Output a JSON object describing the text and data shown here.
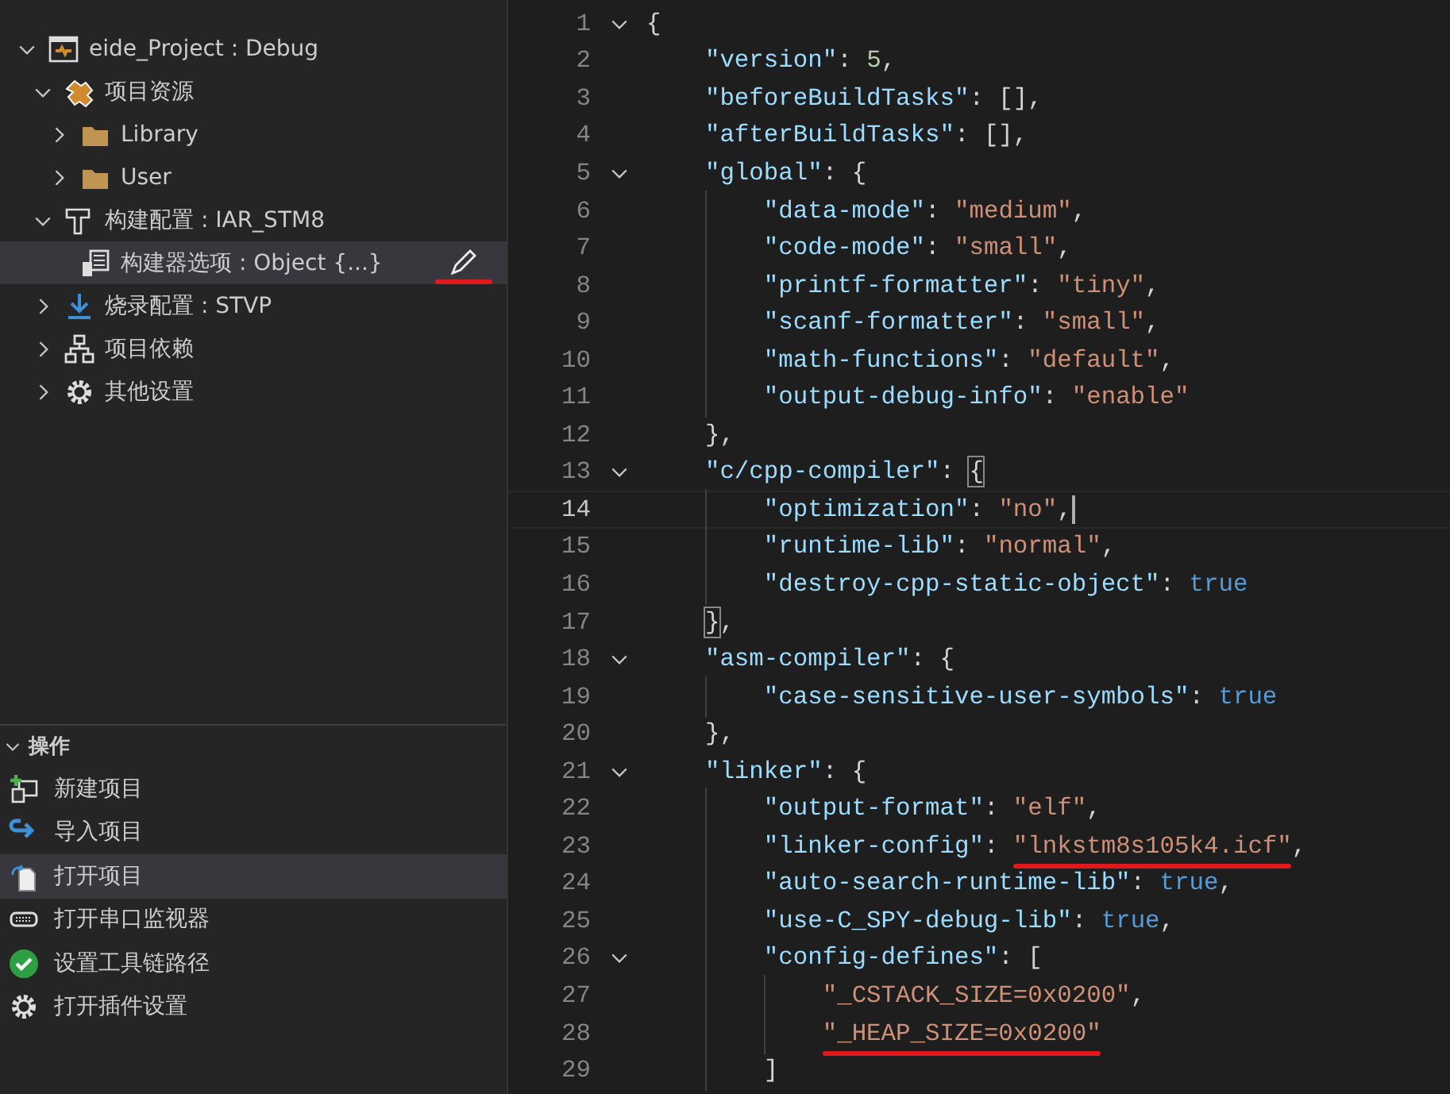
{
  "sidebar": {
    "tree": [
      {
        "label": "eide_Project : Debug",
        "kind": "project",
        "expanded": true,
        "selected": false,
        "children": [
          {
            "label": "项目资源",
            "kind": "sources",
            "expanded": true,
            "selected": false,
            "children": [
              {
                "label": "Library",
                "kind": "folder",
                "expanded": false,
                "selected": false
              },
              {
                "label": "User",
                "kind": "folder",
                "expanded": false,
                "selected": false
              }
            ]
          },
          {
            "label": "构建配置 : IAR_STM8",
            "kind": "build",
            "expanded": true,
            "selected": false,
            "children": [
              {
                "label": "构建器选项 : Object {...}",
                "kind": "options",
                "selected": true,
                "marked": true
              }
            ]
          },
          {
            "label": "烧录配置 : STVP",
            "kind": "flash",
            "expanded": false,
            "selected": false
          },
          {
            "label": "项目依赖",
            "kind": "deps",
            "expanded": false,
            "selected": false
          },
          {
            "label": "其他设置",
            "kind": "gear",
            "expanded": false,
            "selected": false
          }
        ]
      }
    ],
    "actions_header": {
      "label": "操作",
      "expanded": true
    },
    "actions": [
      {
        "label": "新建项目",
        "kind": "new",
        "selected": false
      },
      {
        "label": "导入项目",
        "kind": "import",
        "selected": false
      },
      {
        "label": "打开项目",
        "kind": "open",
        "selected": true
      },
      {
        "label": "打开串口监视器",
        "kind": "serial",
        "selected": false
      },
      {
        "label": "设置工具链路径",
        "kind": "check",
        "selected": false
      },
      {
        "label": "打开插件设置",
        "kind": "gear",
        "selected": false
      }
    ]
  },
  "editor": {
    "lines": [
      {
        "number": "1",
        "foldable": true,
        "current": false,
        "tokens": [
          {
            "kind": "punct",
            "text": "{"
          }
        ]
      },
      {
        "number": "2",
        "foldable": false,
        "current": false,
        "tokens": [
          {
            "kind": "key",
            "text": "    \"version\""
          },
          {
            "kind": "punct",
            "text": ": "
          },
          {
            "kind": "number",
            "text": "5"
          },
          {
            "kind": "punct",
            "text": ","
          }
        ]
      },
      {
        "number": "3",
        "foldable": false,
        "current": false,
        "tokens": [
          {
            "kind": "key",
            "text": "    \"beforeBuildTasks\""
          },
          {
            "kind": "punct",
            "text": ": [],"
          }
        ]
      },
      {
        "number": "4",
        "foldable": false,
        "current": false,
        "tokens": [
          {
            "kind": "key",
            "text": "    \"afterBuildTasks\""
          },
          {
            "kind": "punct",
            "text": ": [],"
          }
        ]
      },
      {
        "number": "5",
        "foldable": true,
        "current": false,
        "tokens": [
          {
            "kind": "key",
            "text": "    \"global\""
          },
          {
            "kind": "punct",
            "text": ": {"
          }
        ]
      },
      {
        "number": "6",
        "foldable": false,
        "current": false,
        "tokens": [
          {
            "kind": "key",
            "text": "        \"data-mode\""
          },
          {
            "kind": "punct",
            "text": ": "
          },
          {
            "kind": "string",
            "text": "\"medium\""
          },
          {
            "kind": "punct",
            "text": ","
          }
        ]
      },
      {
        "number": "7",
        "foldable": false,
        "current": false,
        "tokens": [
          {
            "kind": "key",
            "text": "        \"code-mode\""
          },
          {
            "kind": "punct",
            "text": ": "
          },
          {
            "kind": "string",
            "text": "\"small\""
          },
          {
            "kind": "punct",
            "text": ","
          }
        ]
      },
      {
        "number": "8",
        "foldable": false,
        "current": false,
        "tokens": [
          {
            "kind": "key",
            "text": "        \"printf-formatter\""
          },
          {
            "kind": "punct",
            "text": ": "
          },
          {
            "kind": "string",
            "text": "\"tiny\""
          },
          {
            "kind": "punct",
            "text": ","
          }
        ]
      },
      {
        "number": "9",
        "foldable": false,
        "current": false,
        "tokens": [
          {
            "kind": "key",
            "text": "        \"scanf-formatter\""
          },
          {
            "kind": "punct",
            "text": ": "
          },
          {
            "kind": "string",
            "text": "\"small\""
          },
          {
            "kind": "punct",
            "text": ","
          }
        ]
      },
      {
        "number": "10",
        "foldable": false,
        "current": false,
        "tokens": [
          {
            "kind": "key",
            "text": "        \"math-functions\""
          },
          {
            "kind": "punct",
            "text": ": "
          },
          {
            "kind": "string",
            "text": "\"default\""
          },
          {
            "kind": "punct",
            "text": ","
          }
        ]
      },
      {
        "number": "11",
        "foldable": false,
        "current": false,
        "tokens": [
          {
            "kind": "key",
            "text": "        \"output-debug-info\""
          },
          {
            "kind": "punct",
            "text": ": "
          },
          {
            "kind": "string",
            "text": "\"enable\""
          }
        ]
      },
      {
        "number": "12",
        "foldable": false,
        "current": false,
        "tokens": [
          {
            "kind": "punct",
            "text": "    },"
          }
        ]
      },
      {
        "number": "13",
        "foldable": true,
        "current": false,
        "tokens": [
          {
            "kind": "key",
            "text": "    \"c/cpp-compiler\""
          },
          {
            "kind": "punct",
            "text": ": "
          },
          {
            "kind": "bracket",
            "text": "{"
          }
        ]
      },
      {
        "number": "14",
        "foldable": false,
        "current": true,
        "tokens": [
          {
            "kind": "key",
            "text": "        \"optimization\""
          },
          {
            "kind": "punct",
            "text": ": "
          },
          {
            "kind": "string",
            "text": "\"no\""
          },
          {
            "kind": "punct",
            "text": ","
          }
        ]
      },
      {
        "number": "15",
        "foldable": false,
        "current": false,
        "tokens": [
          {
            "kind": "key",
            "text": "        \"runtime-lib\""
          },
          {
            "kind": "punct",
            "text": ": "
          },
          {
            "kind": "string",
            "text": "\"normal\""
          },
          {
            "kind": "punct",
            "text": ","
          }
        ]
      },
      {
        "number": "16",
        "foldable": false,
        "current": false,
        "tokens": [
          {
            "kind": "key",
            "text": "        \"destroy-cpp-static-object\""
          },
          {
            "kind": "punct",
            "text": ": "
          },
          {
            "kind": "bool",
            "text": "true"
          }
        ]
      },
      {
        "number": "17",
        "foldable": false,
        "current": false,
        "tokens": [
          {
            "kind": "bracket",
            "text": "    }"
          },
          {
            "kind": "punct",
            "text": ","
          }
        ]
      },
      {
        "number": "18",
        "foldable": true,
        "current": false,
        "tokens": [
          {
            "kind": "key",
            "text": "    \"asm-compiler\""
          },
          {
            "kind": "punct",
            "text": ": {"
          }
        ]
      },
      {
        "number": "19",
        "foldable": false,
        "current": false,
        "tokens": [
          {
            "kind": "key",
            "text": "        \"case-sensitive-user-symbols\""
          },
          {
            "kind": "punct",
            "text": ": "
          },
          {
            "kind": "bool",
            "text": "true"
          }
        ]
      },
      {
        "number": "20",
        "foldable": false,
        "current": false,
        "tokens": [
          {
            "kind": "punct",
            "text": "    },"
          }
        ]
      },
      {
        "number": "21",
        "foldable": true,
        "current": false,
        "tokens": [
          {
            "kind": "key",
            "text": "    \"linker\""
          },
          {
            "kind": "punct",
            "text": ": {"
          }
        ]
      },
      {
        "number": "22",
        "foldable": false,
        "current": false,
        "tokens": [
          {
            "kind": "key",
            "text": "        \"output-format\""
          },
          {
            "kind": "punct",
            "text": ": "
          },
          {
            "kind": "string",
            "text": "\"elf\""
          },
          {
            "kind": "punct",
            "text": ","
          }
        ]
      },
      {
        "number": "23",
        "foldable": false,
        "current": false,
        "tokens": [
          {
            "kind": "key",
            "text": "        \"linker-config\""
          },
          {
            "kind": "punct",
            "text": ": "
          },
          {
            "kind": "string",
            "text": "\"lnkstm8s105k4.icf\"",
            "marked": true
          },
          {
            "kind": "punct",
            "text": ","
          }
        ]
      },
      {
        "number": "24",
        "foldable": false,
        "current": false,
        "tokens": [
          {
            "kind": "key",
            "text": "        \"auto-search-runtime-lib\""
          },
          {
            "kind": "punct",
            "text": ": "
          },
          {
            "kind": "bool",
            "text": "true"
          },
          {
            "kind": "punct",
            "text": ","
          }
        ]
      },
      {
        "number": "25",
        "foldable": false,
        "current": false,
        "tokens": [
          {
            "kind": "key",
            "text": "        \"use-C_SPY-debug-lib\""
          },
          {
            "kind": "punct",
            "text": ": "
          },
          {
            "kind": "bool",
            "text": "true"
          },
          {
            "kind": "punct",
            "text": ","
          }
        ]
      },
      {
        "number": "26",
        "foldable": true,
        "current": false,
        "tokens": [
          {
            "kind": "key",
            "text": "        \"config-defines\""
          },
          {
            "kind": "punct",
            "text": ": ["
          }
        ]
      },
      {
        "number": "27",
        "foldable": false,
        "current": false,
        "tokens": [
          {
            "kind": "string",
            "text": "            \"_CSTACK_SIZE=0x0200\""
          },
          {
            "kind": "punct",
            "text": ","
          }
        ]
      },
      {
        "number": "28",
        "foldable": false,
        "current": false,
        "tokens": [
          {
            "kind": "string",
            "text": "            \"_HEAP_SIZE=0x0200\"",
            "marked": true
          }
        ]
      },
      {
        "number": "29",
        "foldable": false,
        "current": false,
        "tokens": [
          {
            "kind": "punct",
            "text": "        ]"
          }
        ]
      }
    ]
  }
}
